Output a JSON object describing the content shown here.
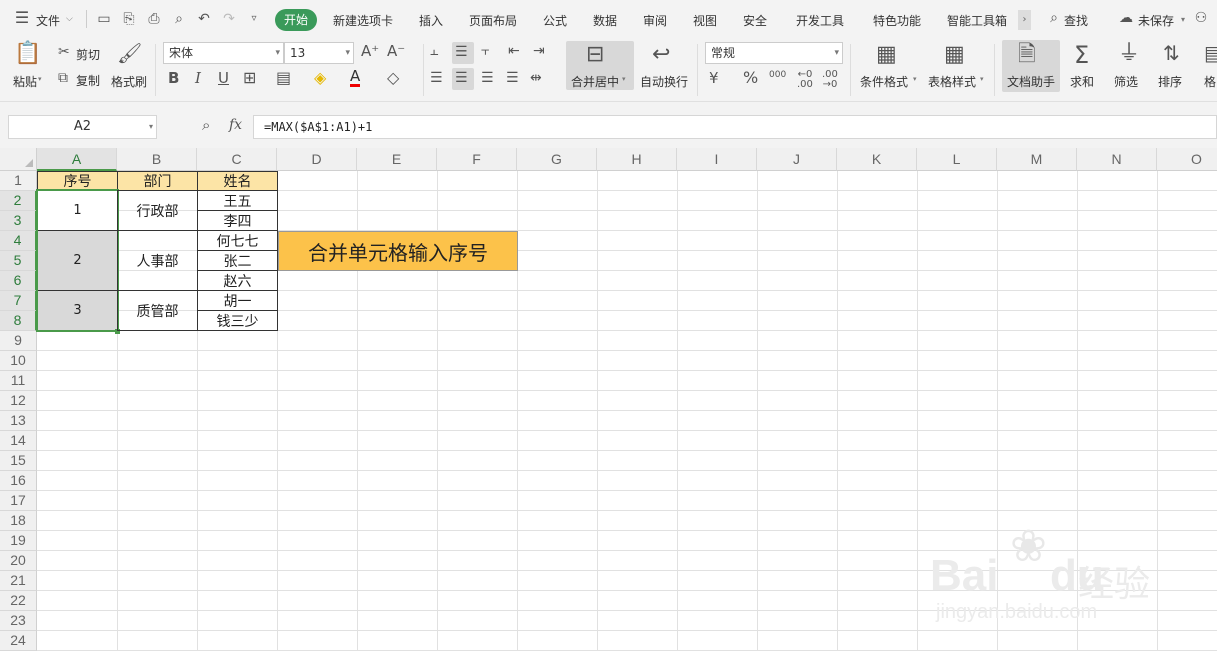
{
  "menubar": {
    "file_label": "文件",
    "tabs": [
      "开始",
      "新建选项卡",
      "插入",
      "页面布局",
      "公式",
      "数据",
      "审阅",
      "视图",
      "安全",
      "开发工具",
      "特色功能",
      "智能工具箱"
    ],
    "search_label": "查找",
    "unsaved_label": "未保存",
    "accent": "#3a9a5a"
  },
  "ribbon": {
    "paste": "粘贴",
    "cut": "剪切",
    "copy": "复制",
    "format_painter": "格式刷",
    "font_name": "宋体",
    "font_size": "13",
    "bold": "B",
    "italic": "I",
    "underline": "U",
    "font_color_letter": "A",
    "merge_center": "合并居中",
    "wrap_text": "自动换行",
    "number_format": "常规",
    "percent": "%",
    "thousands": "000",
    "conditional_format": "条件格式",
    "table_style": "表格样式",
    "doc_assistant": "文档助手",
    "sum": "求和",
    "filter": "筛选",
    "sort": "排序",
    "format_cut": "格"
  },
  "formula_bar": {
    "name_box": "A2",
    "fx": "fx",
    "formula": "=MAX($A$1:A1)+1"
  },
  "sheet": {
    "columns": [
      "A",
      "B",
      "C",
      "D",
      "E",
      "F",
      "G",
      "H",
      "I",
      "J",
      "K",
      "L",
      "M",
      "N",
      "O"
    ],
    "rows": [
      "1",
      "2",
      "3",
      "4",
      "5",
      "6",
      "7",
      "8",
      "9",
      "10",
      "11",
      "12",
      "13",
      "14",
      "15",
      "16",
      "17",
      "18",
      "19",
      "20",
      "21",
      "22",
      "23",
      "24"
    ],
    "header": {
      "seq": "序号",
      "dept": "部门",
      "name": "姓名"
    },
    "seq_values": [
      "1",
      "2",
      "3"
    ],
    "departments": [
      "行政部",
      "人事部",
      "质管部"
    ],
    "names": [
      "王五",
      "李四",
      "何七七",
      "张二",
      "赵六",
      "胡一",
      "钱三少"
    ],
    "callout": "合并单元格输入序号",
    "header_fill": "#fce4a6",
    "callout_fill": "#fcc24a",
    "selected_fill": "#d9d9d9",
    "selection_border": "#4a9a4a"
  },
  "watermark": {
    "brand": "Bai",
    "brand2": "du",
    "cn": "经验",
    "url": "jingyan.baidu.com"
  }
}
